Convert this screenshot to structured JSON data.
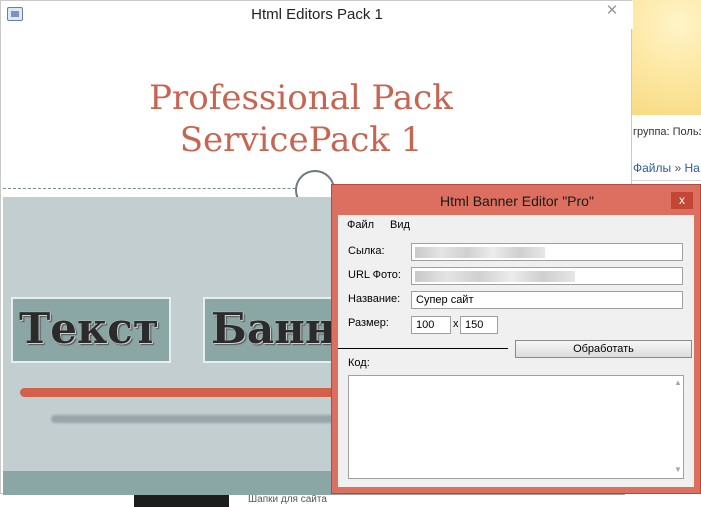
{
  "background": {
    "group_text": "группа: Польз",
    "files_link": "Файлы",
    "crumb_sep": "»",
    "next_link": "На",
    "bottom_text": "Шапки для сайта"
  },
  "main_window": {
    "title": "Html Editors Pack 1",
    "close_glyph": "✕",
    "hero_line1": "Professional Pack",
    "hero_line2": "ServicePack 1",
    "banner_word_1": "Текст",
    "banner_word_2": "Банн"
  },
  "editor": {
    "title": "Html Banner Editor \"Pro\"",
    "close_glyph": "x",
    "menu": {
      "file": "Файл",
      "view": "Вид"
    },
    "fields": {
      "link_label": "Сылка:",
      "photo_label": "URL Фото:",
      "name_label": "Название:",
      "name_value": "Супер сайт",
      "size_label": "Размер:",
      "width_value": "100",
      "size_separator": "x",
      "height_value": "150"
    },
    "process_button": "Обработать",
    "code_label": "Код:",
    "code_value": ""
  },
  "colors": {
    "hero_text": "#c86452",
    "dialog_frame": "#dc6f60",
    "banner_box": "#8aa7a5",
    "banner_bg": "#c3ced1",
    "orange_bar": "#d36049"
  }
}
